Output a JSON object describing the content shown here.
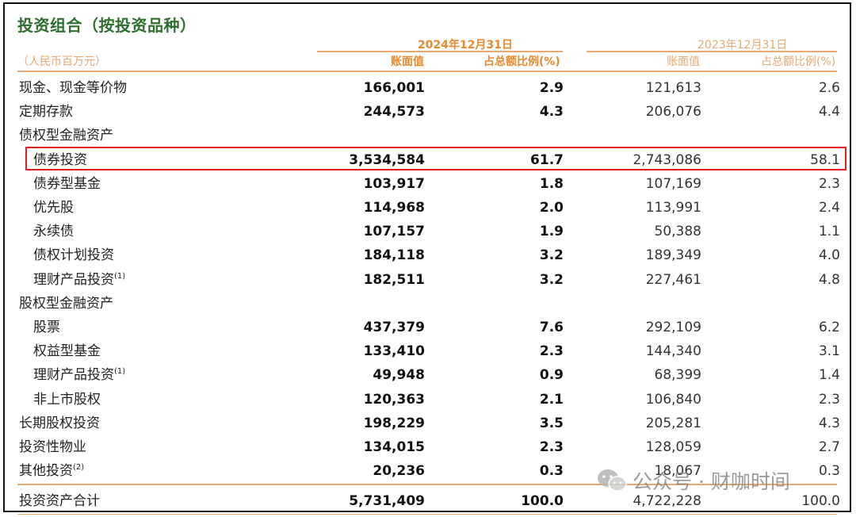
{
  "title": "投资组合（按投资品种）",
  "header": {
    "unit": "（人民币百万元）",
    "period_current": "2024年12月31日",
    "period_prior": "2023年12月31日",
    "col_book_value": "账面值",
    "col_pct_total": "占总额比例(%)"
  },
  "rows": [
    {
      "label": "现金、现金等价物",
      "v1": "166,001",
      "p1": "2.9",
      "v2": "121,613",
      "p2": "2.6",
      "indent": false
    },
    {
      "label": "定期存款",
      "v1": "244,573",
      "p1": "4.3",
      "v2": "206,076",
      "p2": "4.4",
      "indent": false
    },
    {
      "label": "债权型金融资产",
      "v1": "",
      "p1": "",
      "v2": "",
      "p2": "",
      "indent": false
    },
    {
      "label": "债券投资",
      "v1": "3,534,584",
      "p1": "61.7",
      "v2": "2,743,086",
      "p2": "58.1",
      "indent": true
    },
    {
      "label": "债券型基金",
      "v1": "103,917",
      "p1": "1.8",
      "v2": "107,169",
      "p2": "2.3",
      "indent": true
    },
    {
      "label": "优先股",
      "v1": "114,968",
      "p1": "2.0",
      "v2": "113,991",
      "p2": "2.4",
      "indent": true
    },
    {
      "label": "永续债",
      "v1": "107,157",
      "p1": "1.9",
      "v2": "50,388",
      "p2": "1.1",
      "indent": true
    },
    {
      "label": "债权计划投资",
      "v1": "184,118",
      "p1": "3.2",
      "v2": "189,349",
      "p2": "4.0",
      "indent": true
    },
    {
      "label": "理财产品投资",
      "note": "(1)",
      "v1": "182,511",
      "p1": "3.2",
      "v2": "227,461",
      "p2": "4.8",
      "indent": true
    },
    {
      "label": "股权型金融资产",
      "v1": "",
      "p1": "",
      "v2": "",
      "p2": "",
      "indent": false
    },
    {
      "label": "股票",
      "v1": "437,379",
      "p1": "7.6",
      "v2": "292,109",
      "p2": "6.2",
      "indent": true
    },
    {
      "label": "权益型基金",
      "v1": "133,410",
      "p1": "2.3",
      "v2": "144,340",
      "p2": "3.1",
      "indent": true
    },
    {
      "label": "理财产品投资",
      "note": "(1)",
      "v1": "49,948",
      "p1": "0.9",
      "v2": "68,399",
      "p2": "1.4",
      "indent": true
    },
    {
      "label": "非上市股权",
      "v1": "120,363",
      "p1": "2.1",
      "v2": "106,840",
      "p2": "2.3",
      "indent": true
    },
    {
      "label": "长期股权投资",
      "v1": "198,229",
      "p1": "3.5",
      "v2": "205,281",
      "p2": "4.3",
      "indent": false
    },
    {
      "label": "投资性物业",
      "v1": "134,015",
      "p1": "2.3",
      "v2": "128,059",
      "p2": "2.7",
      "indent": false
    },
    {
      "label": "其他投资",
      "note": "(2)",
      "v1": "20,236",
      "p1": "0.3",
      "v2": "18,067",
      "p2": "0.3",
      "indent": false
    }
  ],
  "total": {
    "label": "投资资产合计",
    "v1": "5,731,409",
    "p1": "100.0",
    "v2": "4,722,228",
    "p2": "100.0"
  },
  "watermark": {
    "text": "公众号 · 财咖时间"
  },
  "colors": {
    "title": "#2e6e2e",
    "header_orange": "#e8892e",
    "header_light": "#e8a870",
    "highlight": "#e02020"
  }
}
